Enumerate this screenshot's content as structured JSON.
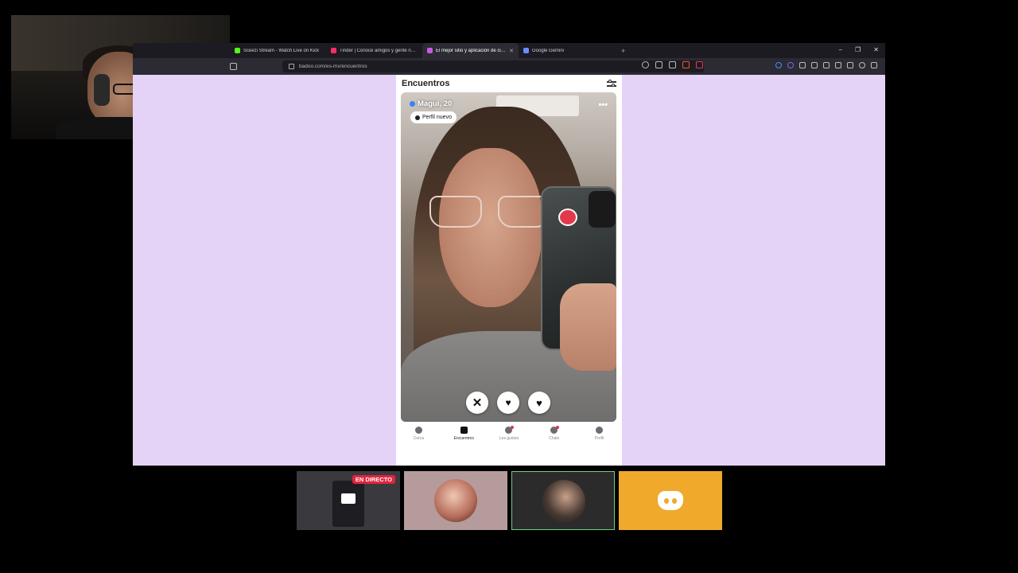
{
  "browser": {
    "tabs": [
      {
        "label": "Sceezi Stream - Watch Live on Kick",
        "favicon_color": "#53fc18",
        "active": false
      },
      {
        "label": "Tinder | Conocé amigos y gente nueva",
        "favicon_color": "#fd2d64",
        "active": false
      },
      {
        "label": "El mejor sitio y aplicación de citas",
        "favicon_color": "#c85adf",
        "active": true
      },
      {
        "label": "Google Gemini",
        "favicon_color": "#6b8cff",
        "active": false
      }
    ],
    "new_tab": "+",
    "window_controls": [
      "–",
      "❐",
      "✕"
    ],
    "url": "badoo.com/es-mx/encuentros"
  },
  "app": {
    "title": "Encuentros",
    "profile": {
      "name_age": "Magui, 20",
      "badge": "Perfil nuevo"
    },
    "more_label": "•••",
    "actions": [
      {
        "name": "dislike-button",
        "glyph": "✕"
      },
      {
        "name": "superlike-button",
        "glyph": "♥"
      },
      {
        "name": "like-button",
        "glyph": "♥"
      }
    ],
    "nav": [
      {
        "label": "Cerca",
        "icon": "location-pin-icon",
        "active": false,
        "dot": false
      },
      {
        "label": "Encuentros",
        "icon": "cards-icon",
        "active": true,
        "dot": false
      },
      {
        "label": "Les gustas",
        "icon": "hearts-icon",
        "active": false,
        "dot": true
      },
      {
        "label": "Chats",
        "icon": "chat-icon",
        "active": false,
        "dot": true
      },
      {
        "label": "Perfil",
        "icon": "person-icon",
        "active": false,
        "dot": false
      }
    ]
  },
  "stream": {
    "live_badge": "EN DIRECTO"
  },
  "colors": {
    "page_bg": "#e5d2f7",
    "browser_chrome": "#1c1b22",
    "live_red": "#e0243e",
    "discord_tile": "#f0a92a"
  }
}
